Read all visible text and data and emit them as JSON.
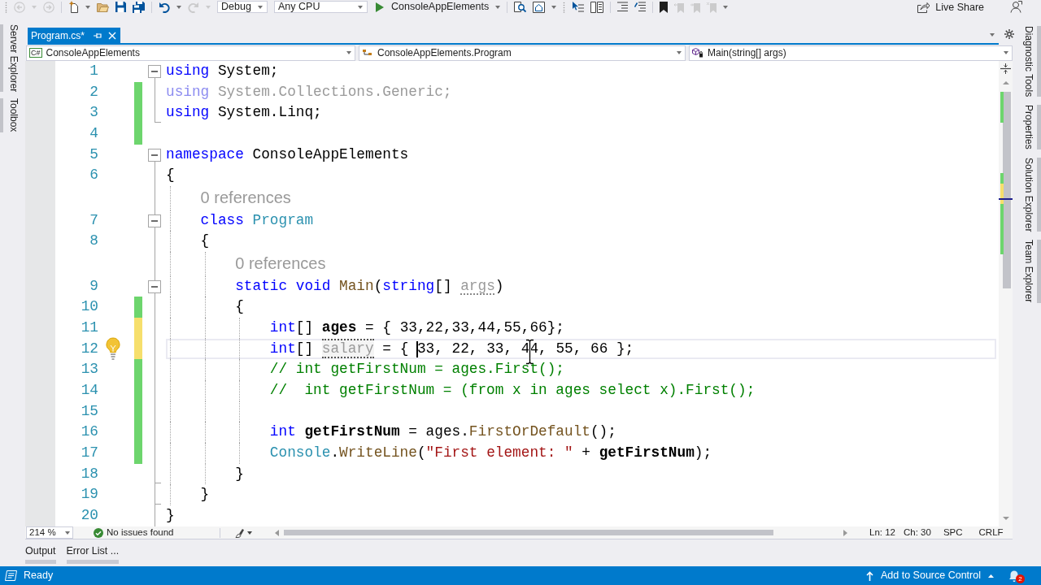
{
  "toolbar": {
    "items": [
      {
        "kind": "gripper"
      },
      {
        "kind": "back",
        "disabled": true
      },
      {
        "kind": "caret",
        "disabled": true
      },
      {
        "kind": "forward",
        "disabled": true
      },
      {
        "kind": "separator"
      },
      {
        "kind": "new_project",
        "disabled": false
      },
      {
        "kind": "caret",
        "disabled": false
      },
      {
        "kind": "open",
        "disabled": false
      },
      {
        "kind": "save",
        "disabled": false
      },
      {
        "kind": "save_all",
        "disabled": false
      },
      {
        "kind": "separator"
      },
      {
        "kind": "undo",
        "disabled": false
      },
      {
        "kind": "caret",
        "disabled": false
      },
      {
        "kind": "redo",
        "disabled": true
      },
      {
        "kind": "caret",
        "disabled": true
      },
      {
        "kind": "combo",
        "text": "Debug"
      },
      {
        "kind": "combo",
        "text": "Any CPU"
      },
      {
        "kind": "start",
        "text": "ConsoleAppElements"
      },
      {
        "kind": "caret",
        "disabled": false
      },
      {
        "kind": "separator"
      },
      {
        "kind": "find",
        "disabled": false
      },
      {
        "kind": "home",
        "disabled": false
      },
      {
        "kind": "caret",
        "disabled": false
      },
      {
        "kind": "gripper"
      },
      {
        "kind": "select_list",
        "disabled": false
      },
      {
        "kind": "columns",
        "disabled": false
      },
      {
        "kind": "separator"
      },
      {
        "kind": "indent_lines",
        "disabled": false
      },
      {
        "kind": "comment_lines",
        "disabled": false
      },
      {
        "kind": "separator"
      },
      {
        "kind": "bookmark",
        "disabled": false
      },
      {
        "kind": "bookmark_prev",
        "disabled": true
      },
      {
        "kind": "bookmark_next",
        "disabled": true
      },
      {
        "kind": "bookmark_clear",
        "disabled": true
      },
      {
        "kind": "caret",
        "disabled": false
      }
    ],
    "live_share": "Live Share"
  },
  "left_tool_tabs": [
    {
      "label": "Server Explorer"
    },
    {
      "label": "Toolbox"
    }
  ],
  "document_tabs": [
    {
      "label": "Program.cs*",
      "selected": true
    }
  ],
  "navigation_bar": {
    "project_badge": "C#",
    "project": "ConsoleAppElements",
    "type": "ConsoleAppElements.Program",
    "member": "Main(string[] args)"
  },
  "editor": {
    "lines": [
      {
        "number": "1",
        "kind": "fold",
        "tokens": [
          {
            "kind": "keyword",
            "text": "using"
          },
          {
            "kind": "plain",
            "text": " System;"
          }
        ]
      },
      {
        "number": "2",
        "kind": "inside",
        "color": "#6dd56d",
        "tokens": [
          {
            "kind": "faded_keyword",
            "text": "using"
          },
          {
            "kind": "faded",
            "text": " System.Collections.Generic;"
          }
        ]
      },
      {
        "number": "3",
        "kind": "end",
        "color": "#6dd56d",
        "tokens": [
          {
            "kind": "keyword",
            "text": "using"
          },
          {
            "kind": "plain",
            "text": " System.Linq;"
          }
        ]
      },
      {
        "number": "4",
        "kind": "outside",
        "color": "#6dd56d"
      },
      {
        "number": "5",
        "kind": "fold",
        "tokens": [
          {
            "kind": "keyword",
            "text": "namespace"
          },
          {
            "kind": "plain",
            "text": " ConsoleAppElements"
          }
        ]
      },
      {
        "number": "6",
        "kind": "inside",
        "tokens": [
          {
            "kind": "plain",
            "text": "{"
          }
        ]
      },
      {
        "number": "7",
        "references": "0 references",
        "kind": "fold",
        "tokens": [
          {
            "kind": "keyword",
            "text": "    class"
          },
          {
            "kind": "type",
            "text": " Program"
          }
        ]
      },
      {
        "number": "8",
        "kind": "inside",
        "tokens": [
          {
            "kind": "plain",
            "text": "    {"
          }
        ]
      },
      {
        "number": "9",
        "references": "0 references",
        "kind": "fold",
        "tokens": [
          {
            "kind": "keyword",
            "text": "        static void"
          },
          {
            "kind": "method",
            "text": " Main"
          },
          {
            "kind": "plain",
            "text": "("
          },
          {
            "kind": "keyword",
            "text": "string"
          },
          {
            "kind": "plain",
            "text": "[] "
          },
          {
            "kind": "unused",
            "text": "args"
          },
          {
            "kind": "plain",
            "text": ")"
          }
        ]
      },
      {
        "number": "10",
        "kind": "inside",
        "color": "#6dd56d",
        "tokens": [
          {
            "kind": "plain",
            "text": "        {"
          }
        ]
      },
      {
        "number": "11",
        "kind": "inside",
        "color": "#f6df6c",
        "tokens": [
          {
            "kind": "keyword",
            "text": "            int"
          },
          {
            "kind": "plain",
            "text": "[] "
          },
          {
            "kind": "local",
            "text": "ages"
          },
          {
            "kind": "plain",
            "text": " = { 33,22,33,44,55,66};"
          }
        ]
      },
      {
        "number": "12",
        "kind": "inside",
        "color": "#f6df6c",
        "lightbulb": true,
        "current": true,
        "tokens": [
          {
            "kind": "keyword",
            "text": "            int"
          },
          {
            "kind": "plain",
            "text": "[] "
          },
          {
            "kind": "unused_local",
            "text": "salary"
          },
          {
            "kind": "plain",
            "text": " = { "
          },
          {
            "kind": "caret"
          },
          {
            "kind": "plain",
            "text": "33, 22, 33, 4"
          },
          {
            "kind": "pointer"
          },
          {
            "kind": "plain",
            "text": "4, 55, 66 };"
          }
        ]
      },
      {
        "number": "13",
        "kind": "inside",
        "color": "#6dd56d",
        "tokens": [
          {
            "kind": "comment",
            "text": "            // int getFirstNum = ages.First();"
          }
        ]
      },
      {
        "number": "14",
        "kind": "inside",
        "color": "#6dd56d",
        "tokens": [
          {
            "kind": "comment",
            "text": "            //  int getFirstNum = (from x in ages select x).First();"
          }
        ]
      },
      {
        "number": "15",
        "kind": "inside",
        "color": "#6dd56d"
      },
      {
        "number": "16",
        "kind": "inside",
        "color": "#6dd56d",
        "tokens": [
          {
            "kind": "keyword",
            "text": "            int"
          },
          {
            "kind": "local",
            "text": " getFirstNum"
          },
          {
            "kind": "plain",
            "text": " = ages."
          },
          {
            "kind": "method",
            "text": "FirstOrDefault"
          },
          {
            "kind": "plain",
            "text": "();"
          }
        ]
      },
      {
        "number": "17",
        "kind": "inside",
        "color": "#6dd56d",
        "tokens": [
          {
            "kind": "type",
            "text": "            Console"
          },
          {
            "kind": "plain",
            "text": "."
          },
          {
            "kind": "method",
            "text": "WriteLine"
          },
          {
            "kind": "plain",
            "text": "("
          },
          {
            "kind": "string",
            "text": "\"First element: \""
          },
          {
            "kind": "plain",
            "text": " + "
          },
          {
            "kind": "local",
            "text": "getFirstNum"
          },
          {
            "kind": "plain",
            "text": ");"
          }
        ]
      },
      {
        "number": "18",
        "kind": "end",
        "tokens": [
          {
            "kind": "plain",
            "text": "        }"
          }
        ]
      },
      {
        "number": "19",
        "kind": "end",
        "tokens": [
          {
            "kind": "plain",
            "text": "    }"
          }
        ]
      },
      {
        "number": "20",
        "kind": "inside",
        "tokens": [
          {
            "kind": "plain",
            "text": "}"
          }
        ]
      }
    ]
  },
  "editor_footer": {
    "zoom": "214 %",
    "issues": "No issues found",
    "line": "Ln: 12",
    "column": "Ch: 30",
    "indentation": "SPC",
    "line_ending": "CRLF"
  },
  "right_tool_tabs": [
    {
      "label": "Diagnostic Tools"
    },
    {
      "label": "Properties"
    },
    {
      "label": "Solution Explorer"
    },
    {
      "label": "Team Explorer"
    }
  ],
  "bottom_tabs": [
    {
      "label": "Output"
    },
    {
      "label": "Error List ..."
    }
  ],
  "status_bar": {
    "state": "Ready",
    "source_control": "Add to Source Control",
    "notification_count": "2"
  }
}
